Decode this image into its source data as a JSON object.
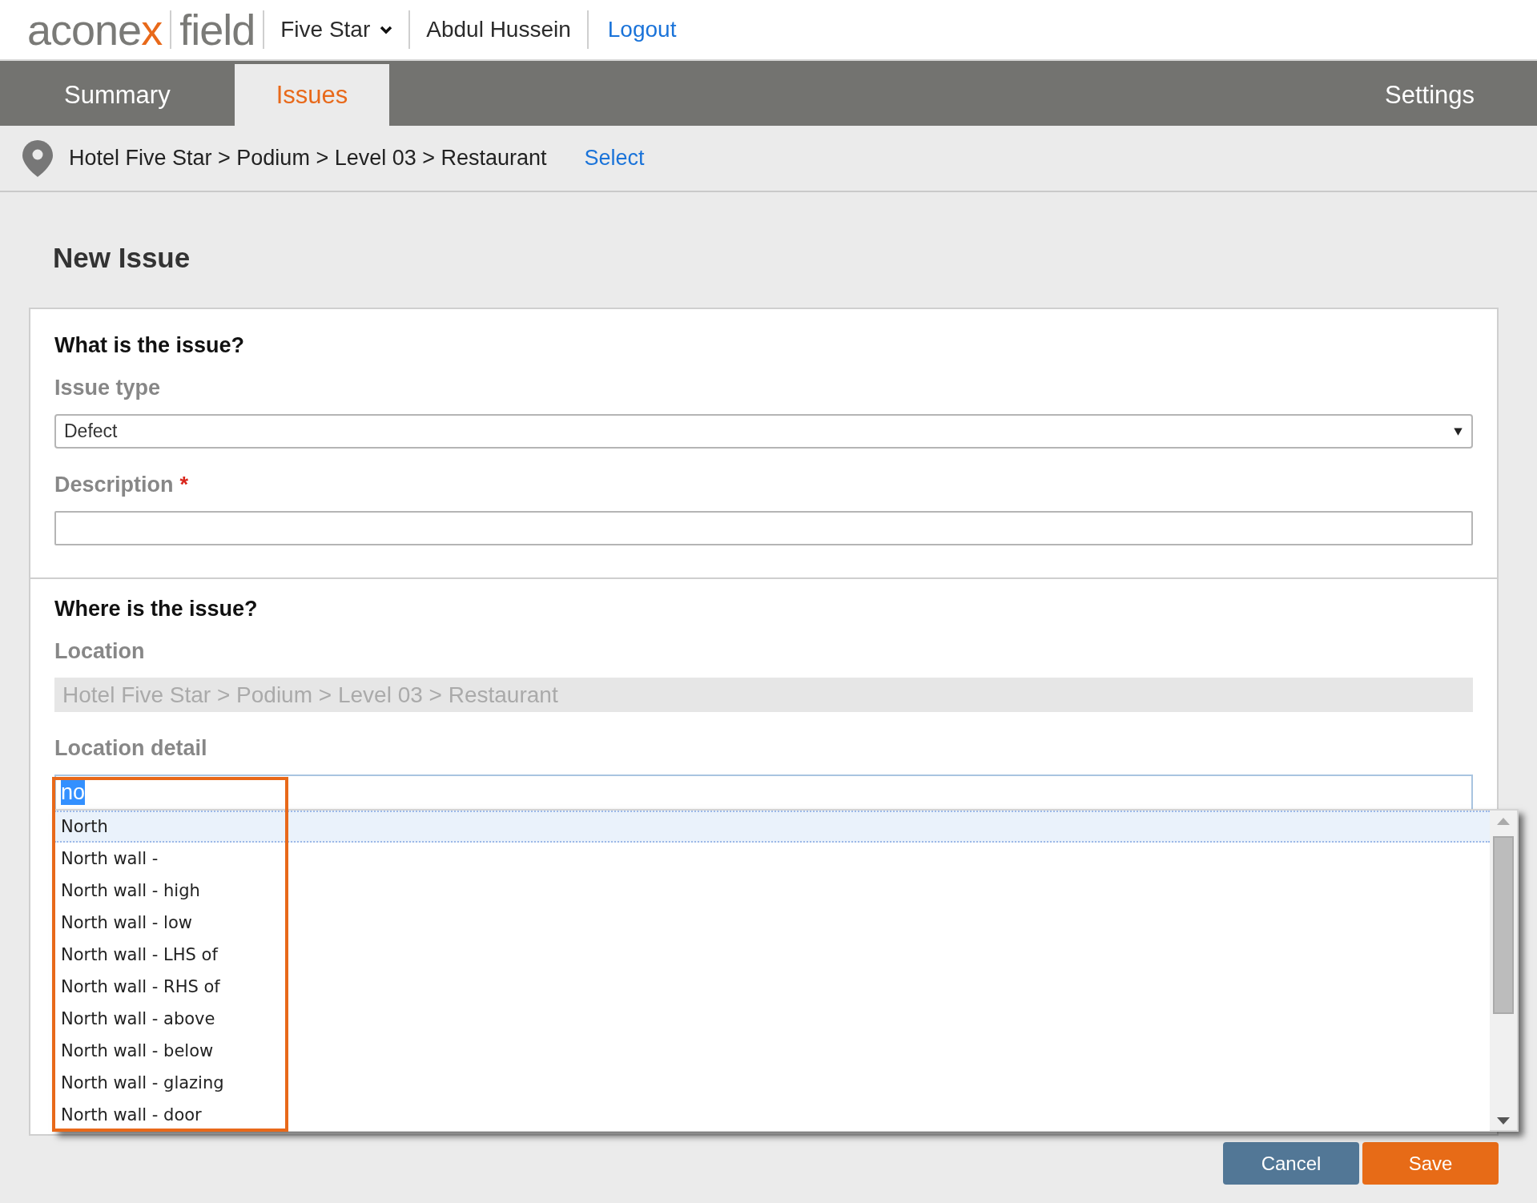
{
  "header": {
    "logo": {
      "brand": "aconex",
      "product": "field"
    },
    "project": "Five Star",
    "user": "Abdul Hussein",
    "logout": "Logout"
  },
  "tabs": [
    {
      "label": "Summary",
      "selected": false
    },
    {
      "label": "Issues",
      "selected": true
    }
  ],
  "settings_tab": "Settings",
  "breadcrumb": {
    "path": "Hotel Five Star > Podium > Level 03 > Restaurant",
    "action": "Select"
  },
  "page_title": "New Issue",
  "required_marker": "*",
  "sections": [
    {
      "heading": "What is the issue?",
      "fields": [
        {
          "kind": "select",
          "label": "Issue type",
          "required": false,
          "value": "Defect"
        },
        {
          "kind": "text",
          "label": "Description",
          "required": true
        }
      ]
    },
    {
      "heading": "Where is the issue?",
      "fields": [
        {
          "kind": "readonly",
          "label": "Location",
          "required": false,
          "value": "Hotel Five Star > Podium > Level 03 > Restaurant"
        },
        {
          "kind": "autocomplete",
          "label": "Location detail",
          "required": false,
          "value": "no",
          "highlighted": true
        }
      ]
    }
  ],
  "suggestions": [
    {
      "label": "North",
      "selected": true
    },
    {
      "label": "North wall -",
      "selected": false
    },
    {
      "label": "North wall - high",
      "selected": false
    },
    {
      "label": "North wall - low",
      "selected": false
    },
    {
      "label": "North wall - LHS of",
      "selected": false
    },
    {
      "label": "North wall - RHS of",
      "selected": false
    },
    {
      "label": "North wall - above",
      "selected": false
    },
    {
      "label": "North wall - below",
      "selected": false
    },
    {
      "label": "North wall - glazing",
      "selected": false
    },
    {
      "label": "North wall - door",
      "selected": false
    }
  ],
  "buttons": [
    {
      "kind": "secondary",
      "label": "Cancel"
    },
    {
      "kind": "primary",
      "label": "Save"
    }
  ]
}
